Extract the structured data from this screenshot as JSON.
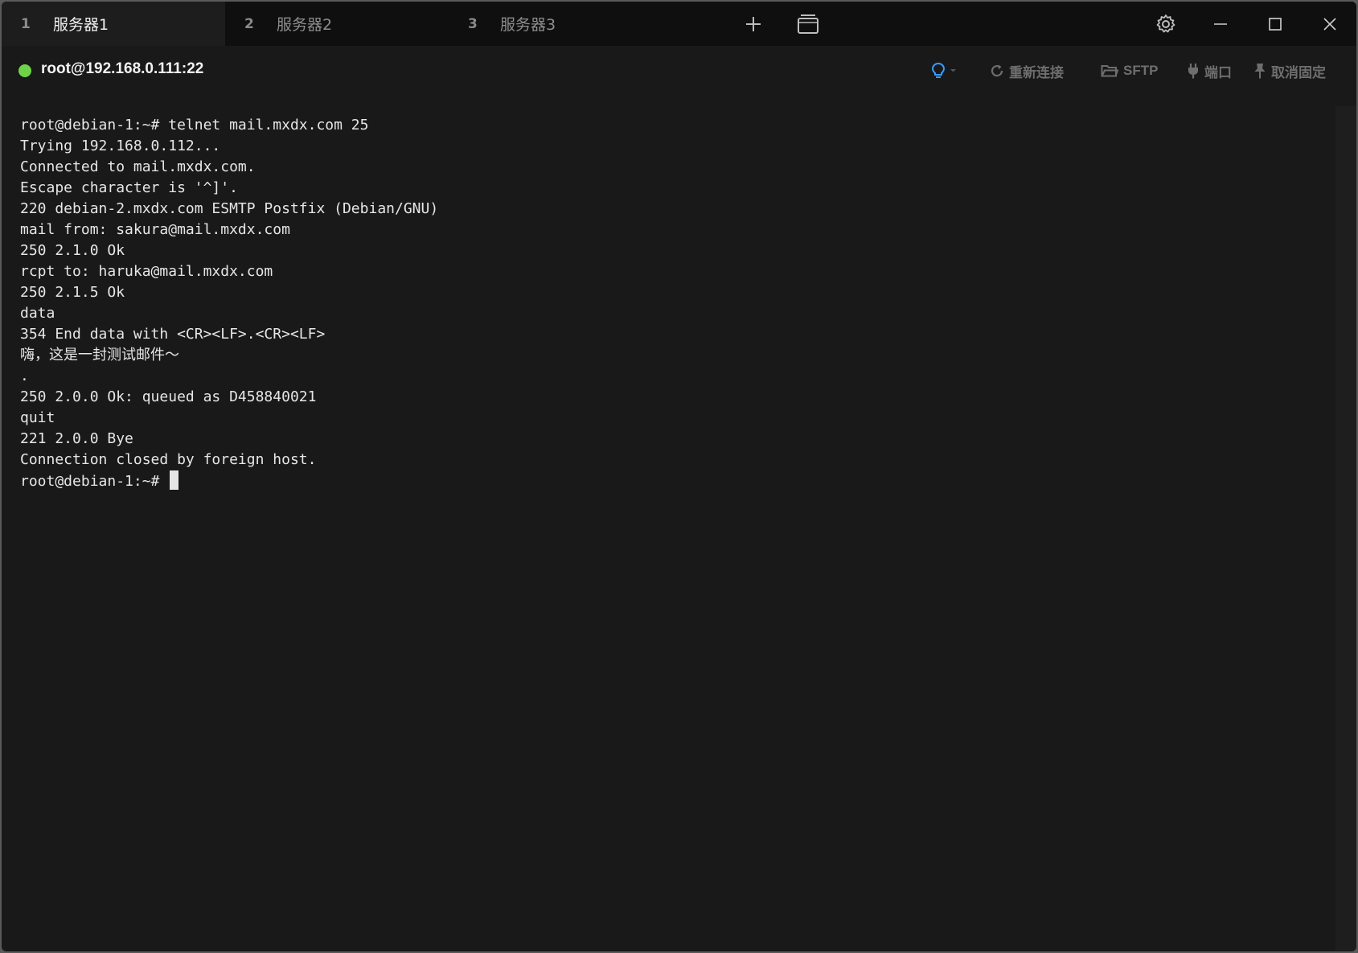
{
  "tabs": [
    {
      "num": "1",
      "label": "服务器1",
      "active": true
    },
    {
      "num": "2",
      "label": "服务器2",
      "active": false
    },
    {
      "num": "3",
      "label": "服务器3",
      "active": false
    }
  ],
  "window_controls": {
    "new_tab_icon": "plus-icon",
    "tabs_overview_icon": "window-stack-icon",
    "settings_icon": "gear-icon",
    "minimize_icon": "minimize-icon",
    "maximize_icon": "maximize-icon",
    "close_icon": "close-icon"
  },
  "session": {
    "host": "root@192.168.0.111:22",
    "status_color": "#6fd34a",
    "tools": [
      {
        "icon": "lightbulb-icon",
        "label": ""
      },
      {
        "icon": "refresh-icon",
        "label": "重新连接"
      },
      {
        "icon": "folder-icon",
        "label": "SFTP"
      },
      {
        "icon": "plug-icon",
        "label": "端口"
      },
      {
        "icon": "pin-icon",
        "label": "取消固定"
      }
    ]
  },
  "terminal": {
    "lines": [
      "root@debian-1:~# telnet mail.mxdx.com 25",
      "Trying 192.168.0.112...",
      "Connected to mail.mxdx.com.",
      "Escape character is '^]'.",
      "220 debian-2.mxdx.com ESMTP Postfix (Debian/GNU)",
      "mail from: sakura@mail.mxdx.com",
      "250 2.1.0 Ok",
      "rcpt to: haruka@mail.mxdx.com",
      "250 2.1.5 Ok",
      "data",
      "354 End data with <CR><LF>.<CR><LF>",
      "嗨，这是一封测试邮件～",
      ".",
      "250 2.0.0 Ok: queued as D458840021",
      "quit",
      "221 2.0.0 Bye",
      "Connection closed by foreign host."
    ],
    "prompt": "root@debian-1:~# "
  }
}
